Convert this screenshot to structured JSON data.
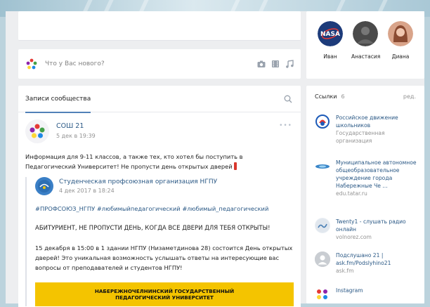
{
  "composer": {
    "placeholder": "Что у Вас нового?",
    "tools": [
      "camera-icon",
      "video-icon",
      "music-icon"
    ]
  },
  "feed": {
    "tab_label": "Записи сообщества",
    "post": {
      "author": "СОШ 21",
      "date": "5 дек в 19:39",
      "text": "Информация для 9-11 классов, а также тех, кто хотел бы поступить в Педагогический Университет! Не пропусти день открытых дверей",
      "repost": {
        "author": "Студенческая профсоюзная организация НГПУ",
        "date": "4 дек 2017 в 18:24",
        "hashtags": "#ПРОФСОЮЗ_НГПУ #любимыйпедагогический #любимый_педагогический",
        "headline": "АБИТУРИЕНТ, НЕ ПРОПУСТИ ДЕНЬ, КОГДА ВСЕ ДВЕРИ ДЛЯ ТЕБЯ ОТКРЫТЫ!",
        "text": "15 декабря в 15:00 в 1 здании НГПУ (Низаметдинова 28) состоится День открытых дверей! Это уникальная возможность услышать ответы на интересующие вас вопросы от преподавателей и студентов НГПУ!",
        "banner_line1": "НАБЕРЕЖНОЧЕЛНИНСКИЙ ГОСУДАРСТВЕННЫЙ",
        "banner_line2": "ПЕДАГОГИЧЕСКИЙ УНИВЕРСИТЕТ"
      }
    }
  },
  "friends": [
    {
      "name": "Иван",
      "color": "#1d3b7a"
    },
    {
      "name": "Анастасия",
      "color": "#4a4a4a"
    },
    {
      "name": "Диана",
      "color": "#c58a6e"
    }
  ],
  "links": {
    "title": "Ссылки",
    "count": "6",
    "edit": "ред.",
    "items": [
      {
        "title": "Российское движение школьников",
        "sub": "Государственная организация",
        "icon": "rdsh-logo-icon"
      },
      {
        "title": "Муниципальное автономное общеобразовательное учреждение города Набережные Че ...",
        "sub": "edu.tatar.ru",
        "icon": "edu-tatar-icon"
      },
      {
        "title": "Twenty1 - слушать радио онлайн",
        "sub": "volnorez.com",
        "icon": "radio-icon"
      },
      {
        "title": "Подслушано 21 | ask.fm/Podslyhino21",
        "sub": "ask.fm",
        "icon": "avatar-placeholder-icon"
      },
      {
        "title": "Instagram",
        "sub": "",
        "icon": "instagram-icon"
      }
    ]
  }
}
